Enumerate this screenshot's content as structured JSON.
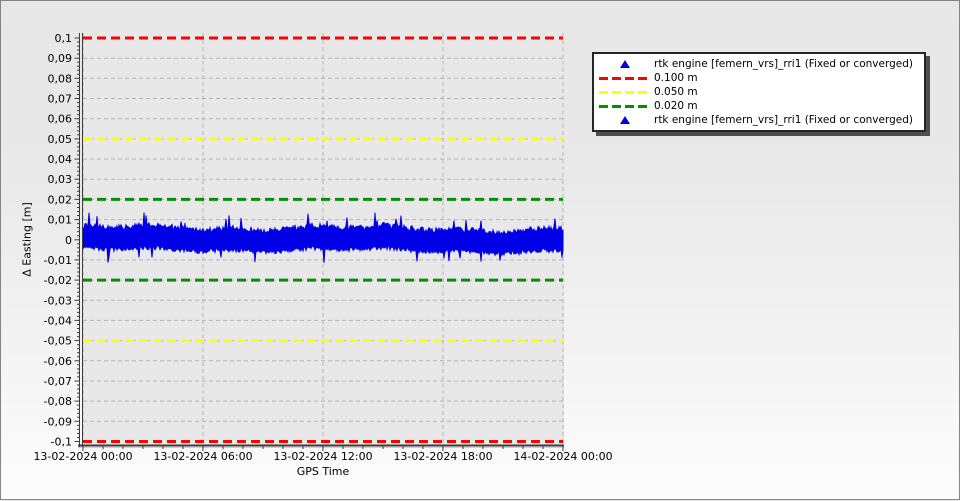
{
  "chart_data": {
    "type": "scatter",
    "title": "",
    "x_axis": {
      "label": "GPS Time",
      "tick_labels": [
        "13-02-2024 00:00",
        "13-02-2024 06:00",
        "13-02-2024 12:00",
        "13-02-2024 18:00",
        "14-02-2024 00:00"
      ],
      "start": "13-02-2024 00:00",
      "end": "14-02-2024 00:00",
      "tick_interval_hours": 6
    },
    "y_axis": {
      "label": "Δ Easting [m]",
      "min": -0.1,
      "max": 0.1,
      "tick_step": 0.01,
      "minor_tick_step": 0.002,
      "tick_labels": [
        "0,1",
        "0,09",
        "0,08",
        "0,07",
        "0,06",
        "0,05",
        "0,04",
        "0,03",
        "0,02",
        "0,01",
        "0",
        "-0,01",
        "-0,02",
        "-0,03",
        "-0,04",
        "-0,05",
        "-0,06",
        "-0,07",
        "-0,08",
        "-0,09",
        "-0,1"
      ]
    },
    "grid": {
      "visible": true,
      "style": "dashed",
      "color": "#b4b4b4"
    },
    "thresholds": [
      {
        "label": "0.100 m",
        "values": [
          0.1,
          -0.1
        ],
        "color": "#fe0000",
        "style": "dashed"
      },
      {
        "label": "0.050 m",
        "values": [
          0.05,
          -0.05
        ],
        "color": "#ffff00",
        "style": "dashed"
      },
      {
        "label": "0.020 m",
        "values": [
          0.02,
          -0.02
        ],
        "color": "#009100",
        "style": "dashed"
      }
    ],
    "series": [
      {
        "name": "rtk engine [femern_vrs]_rri1 (Fixed or converged)",
        "marker": "triangle",
        "color": "#0000e8",
        "mean": 0.0,
        "typical_band": [
          -0.006,
          0.008
        ],
        "extremes": [
          -0.0125,
          0.0135
        ]
      }
    ],
    "legend": {
      "position": "right-top",
      "items": [
        {
          "marker": "triangle",
          "color": "#0000e8",
          "label": "rtk engine [femern_vrs]_rri1 (Fixed or converged)"
        },
        {
          "marker": "dashed-line",
          "color": "#fe0000",
          "label": "0.100 m"
        },
        {
          "marker": "dashed-line",
          "color": "#ffff00",
          "label": "0.050 m"
        },
        {
          "marker": "dashed-line",
          "color": "#009100",
          "label": "0.020 m"
        },
        {
          "marker": "triangle",
          "color": "#0000e8",
          "label": "rtk engine [femern_vrs]_rri1 (Fixed or converged)"
        }
      ]
    }
  }
}
